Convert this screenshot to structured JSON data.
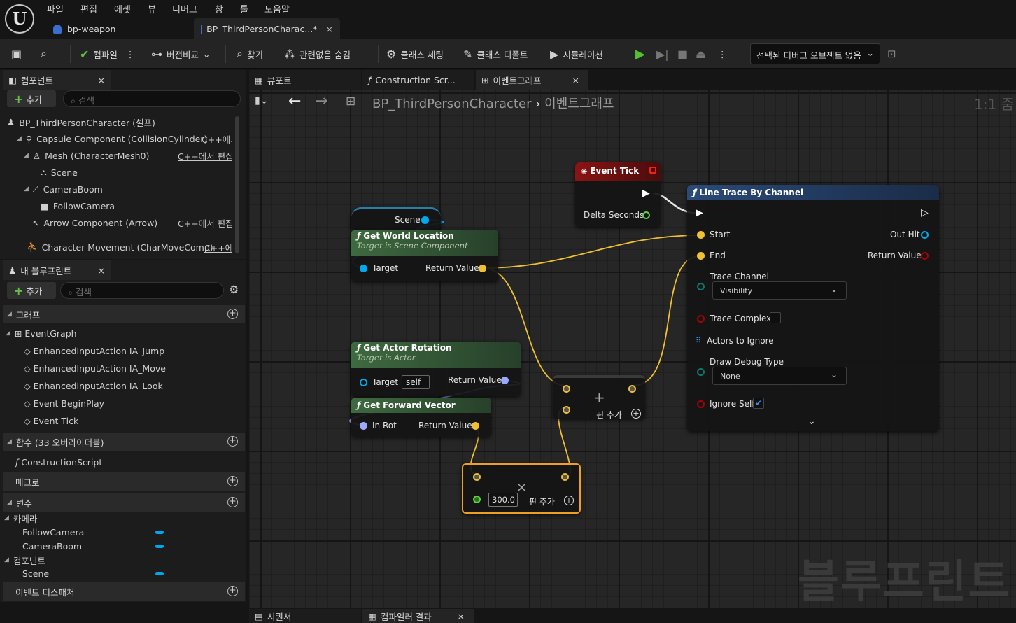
{
  "menubar": {
    "items": [
      "파일",
      "편집",
      "에셋",
      "뷰",
      "디버그",
      "창",
      "툴",
      "도움말"
    ],
    "tabs": [
      {
        "label": "bp-weapon"
      },
      {
        "label": "BP_ThirdPersonCharac...*"
      }
    ]
  },
  "toolbar": {
    "compile": "컴파일",
    "diff": "버전비교",
    "find": "찾기",
    "hide_unrelated": "관련없음 숨김",
    "class_settings": "클래스 세팅",
    "class_defaults": "클래스 디폴트",
    "simulation": "시뮬레이션",
    "debug_object": "선택된 디버그 오브젝트 없음"
  },
  "components": {
    "tab": "컴포넌트",
    "add": "추가",
    "search_placeholder": "검색",
    "root": "BP_ThirdPersonCharacter (셀프)",
    "items": [
      {
        "label": "Capsule Component (CollisionCylinder)",
        "edit": "C++에서"
      },
      {
        "label": "Mesh (CharacterMesh0)",
        "edit": "C++에서 편집"
      },
      {
        "label": "Scene"
      },
      {
        "label": "CameraBoom"
      },
      {
        "label": "FollowCamera"
      },
      {
        "label": "Arrow Component (Arrow)",
        "edit": "C++에서 편집"
      },
      {
        "label": "Character Movement (CharMoveComp)",
        "edit": "C++에서"
      }
    ]
  },
  "myblueprint": {
    "tab": "내 블루프린트",
    "add": "추가",
    "search_placeholder": "검색",
    "graphs_cat": "그래프",
    "event_graph": "EventGraph",
    "events": [
      "EnhancedInputAction IA_Jump",
      "EnhancedInputAction IA_Move",
      "EnhancedInputAction IA_Look",
      "Event BeginPlay",
      "Event Tick"
    ],
    "functions_cat": "함수 (33 오버라이더블)",
    "construction": "ConstructionScript",
    "macros_cat": "매크로",
    "variables_cat": "변수",
    "camera_cat": "카메라",
    "camera_vars": [
      "FollowCamera",
      "CameraBoom"
    ],
    "component_cat": "컴포넌트",
    "component_vars": [
      "Scene"
    ],
    "dispatchers_cat": "이벤트 디스패처"
  },
  "graph_tabs": [
    "뷰포트",
    "Construction Scr...",
    "이벤트그래프"
  ],
  "breadcrumb": {
    "bp": "BP_ThirdPersonCharacter",
    "graph": "이벤트그래프",
    "zoom": "1:1 줌"
  },
  "nodes": {
    "scene": {
      "label": "Scene"
    },
    "get_world_location": {
      "title": "Get World Location",
      "subtitle": "Target is Scene Component",
      "target": "Target",
      "ret": "Return Value"
    },
    "event_tick": {
      "title": "Event Tick",
      "delta": "Delta Seconds"
    },
    "line_trace": {
      "title": "Line Trace By Channel",
      "start": "Start",
      "end": "End",
      "out_hit": "Out Hit",
      "ret": "Return Value",
      "trace_channel": "Trace Channel",
      "trace_channel_value": "Visibility",
      "trace_complex": "Trace Complex",
      "actors_to_ignore": "Actors to Ignore",
      "draw_debug": "Draw Debug Type",
      "draw_debug_value": "None",
      "ignore_self": "Ignore Self"
    },
    "get_actor_rotation": {
      "title": "Get Actor Rotation",
      "subtitle": "Target is Actor",
      "target": "Target",
      "self": "self",
      "ret": "Return Value"
    },
    "get_forward": {
      "title": "Get Forward Vector",
      "in": "In Rot",
      "ret": "Return Value"
    },
    "add": {
      "op": "+",
      "add_pin": "핀 추가"
    },
    "multiply": {
      "op": "×",
      "value": "300.0",
      "add_pin": "핀 추가"
    }
  },
  "watermark": "블루프린트",
  "bottom_tabs": [
    "시퀀서",
    "컴파일러 결과"
  ]
}
